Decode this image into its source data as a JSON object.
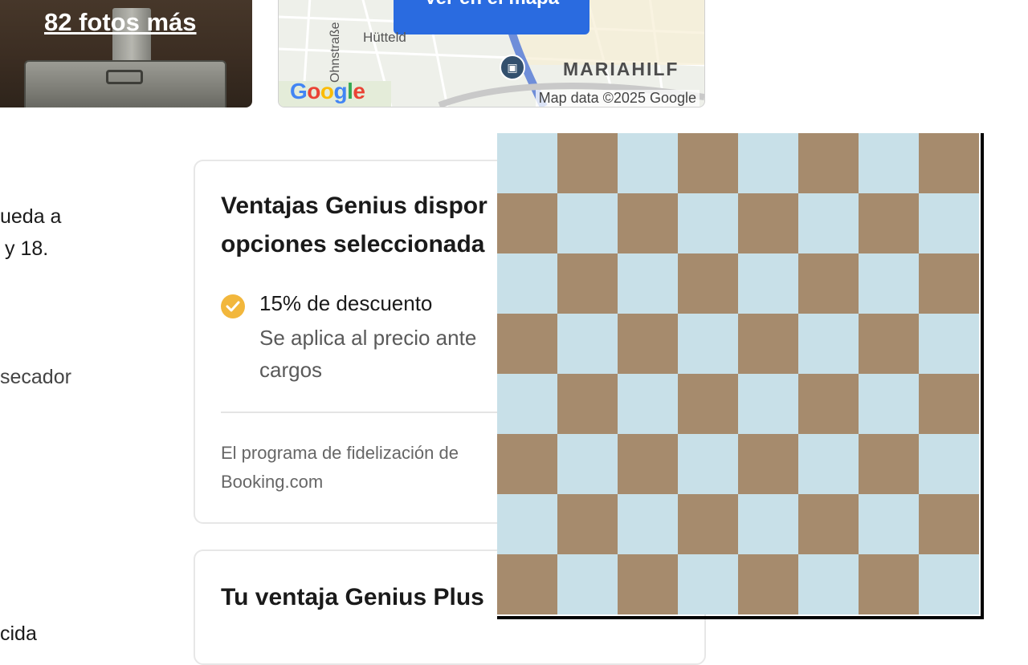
{
  "photos": {
    "more_label": "82 fotos más"
  },
  "map": {
    "button_label": "Ver en el mapa",
    "district_label": "MARIAHILF",
    "street_label": "Ohnstraße",
    "street_label_2": "Hütteld",
    "logo_text": "Google",
    "attribution": "Map data ©2025 Google",
    "colors": {
      "button": "#2a6be0",
      "metro": "#33506e"
    }
  },
  "left_column": {
    "line_1": "ueda a",
    "line_2": "y 18.",
    "line_3": "secador",
    "line_4": "cida"
  },
  "genius_card": {
    "title_line_1": "Ventajas Genius dispor",
    "title_line_2": "opciones seleccionada",
    "benefit_title": "15% de descuento",
    "benefit_desc_line_1": "Se aplica al precio ante",
    "benefit_desc_line_2": "cargos",
    "footer_line_1": "El programa de fidelización de",
    "footer_line_2": "Booking.com",
    "check_icon": "check-circle-icon",
    "check_color": "#f2b73c"
  },
  "plus_card": {
    "title": "Tu ventaja Genius Plus"
  },
  "overlay": {
    "type": "checkerboard",
    "rows": 8,
    "cols": 8,
    "light_color": "#c8e0e8",
    "dark_color": "#a68b6d"
  }
}
